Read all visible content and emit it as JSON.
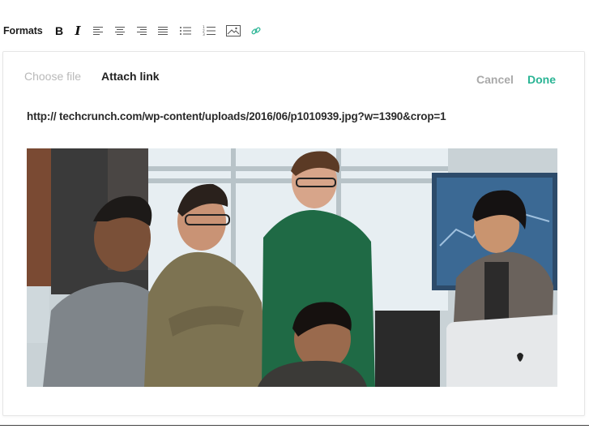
{
  "toolbar": {
    "formats_label": "Formats",
    "bold_label": "B",
    "italic_label": "I",
    "buttons": [
      {
        "name": "align-left-icon"
      },
      {
        "name": "align-center-icon"
      },
      {
        "name": "align-right-icon"
      },
      {
        "name": "align-justify-icon"
      },
      {
        "name": "bullet-list-icon"
      },
      {
        "name": "numbered-list-icon"
      },
      {
        "name": "image-icon"
      },
      {
        "name": "link-icon"
      }
    ]
  },
  "panel": {
    "tabs": [
      {
        "label": "Choose file",
        "active": false
      },
      {
        "label": "Attach link",
        "active": true
      }
    ],
    "cancel_label": "Cancel",
    "done_label": "Done",
    "url": "http:// techcrunch.com/wp-content/uploads/2016/06/p1010939.jpg?w=1390&crop=1",
    "image": {
      "description_name": "attached-photo"
    }
  },
  "colors": {
    "accent": "#29b494",
    "muted": "#a9a9a9",
    "text": "#222222"
  }
}
